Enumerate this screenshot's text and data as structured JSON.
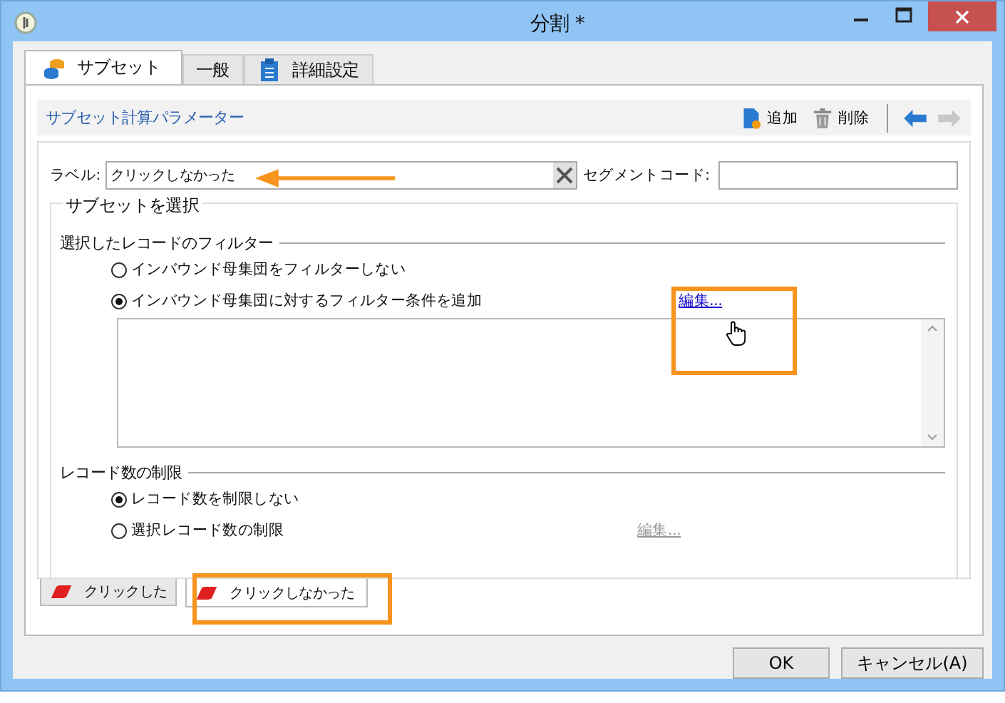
{
  "window": {
    "title": "分割 *"
  },
  "tabs": [
    {
      "label": "サブセット",
      "selected": true
    },
    {
      "label": "一般",
      "selected": false
    },
    {
      "label": "詳細設定",
      "selected": false
    }
  ],
  "section_title": "サブセット計算パラメーター",
  "toolbar": [
    {
      "label": "追加",
      "kind": "add"
    },
    {
      "label": "削除",
      "kind": "delete"
    }
  ],
  "label_field": {
    "label": "ラベル:",
    "value": "クリックしなかった"
  },
  "segment_code": {
    "label": "セグメントコード:"
  },
  "subset_group": {
    "title": "サブセットを選択",
    "filter": {
      "title": "選択したレコードのフィルター",
      "options": [
        {
          "label": "インバウンド母集団をフィルターしない",
          "selected": false
        },
        {
          "label": "インバウンド母集団に対するフィルター条件を追加",
          "selected": true
        }
      ],
      "edit_link": {
        "label": "編集...",
        "disabled": false
      }
    },
    "limit": {
      "title": "レコード数の制限",
      "options": [
        {
          "label": "レコード数を制限しない",
          "selected": true
        },
        {
          "label": "選択レコード数の制限",
          "selected": false
        }
      ],
      "edit_link": {
        "label": "編集...",
        "disabled": true
      }
    }
  },
  "subset_tabs": [
    {
      "label": "クリックした",
      "selected": false
    },
    {
      "label": "クリックしなかった",
      "selected": true
    }
  ],
  "buttons": [
    "OK",
    "キャンセル(A)"
  ]
}
